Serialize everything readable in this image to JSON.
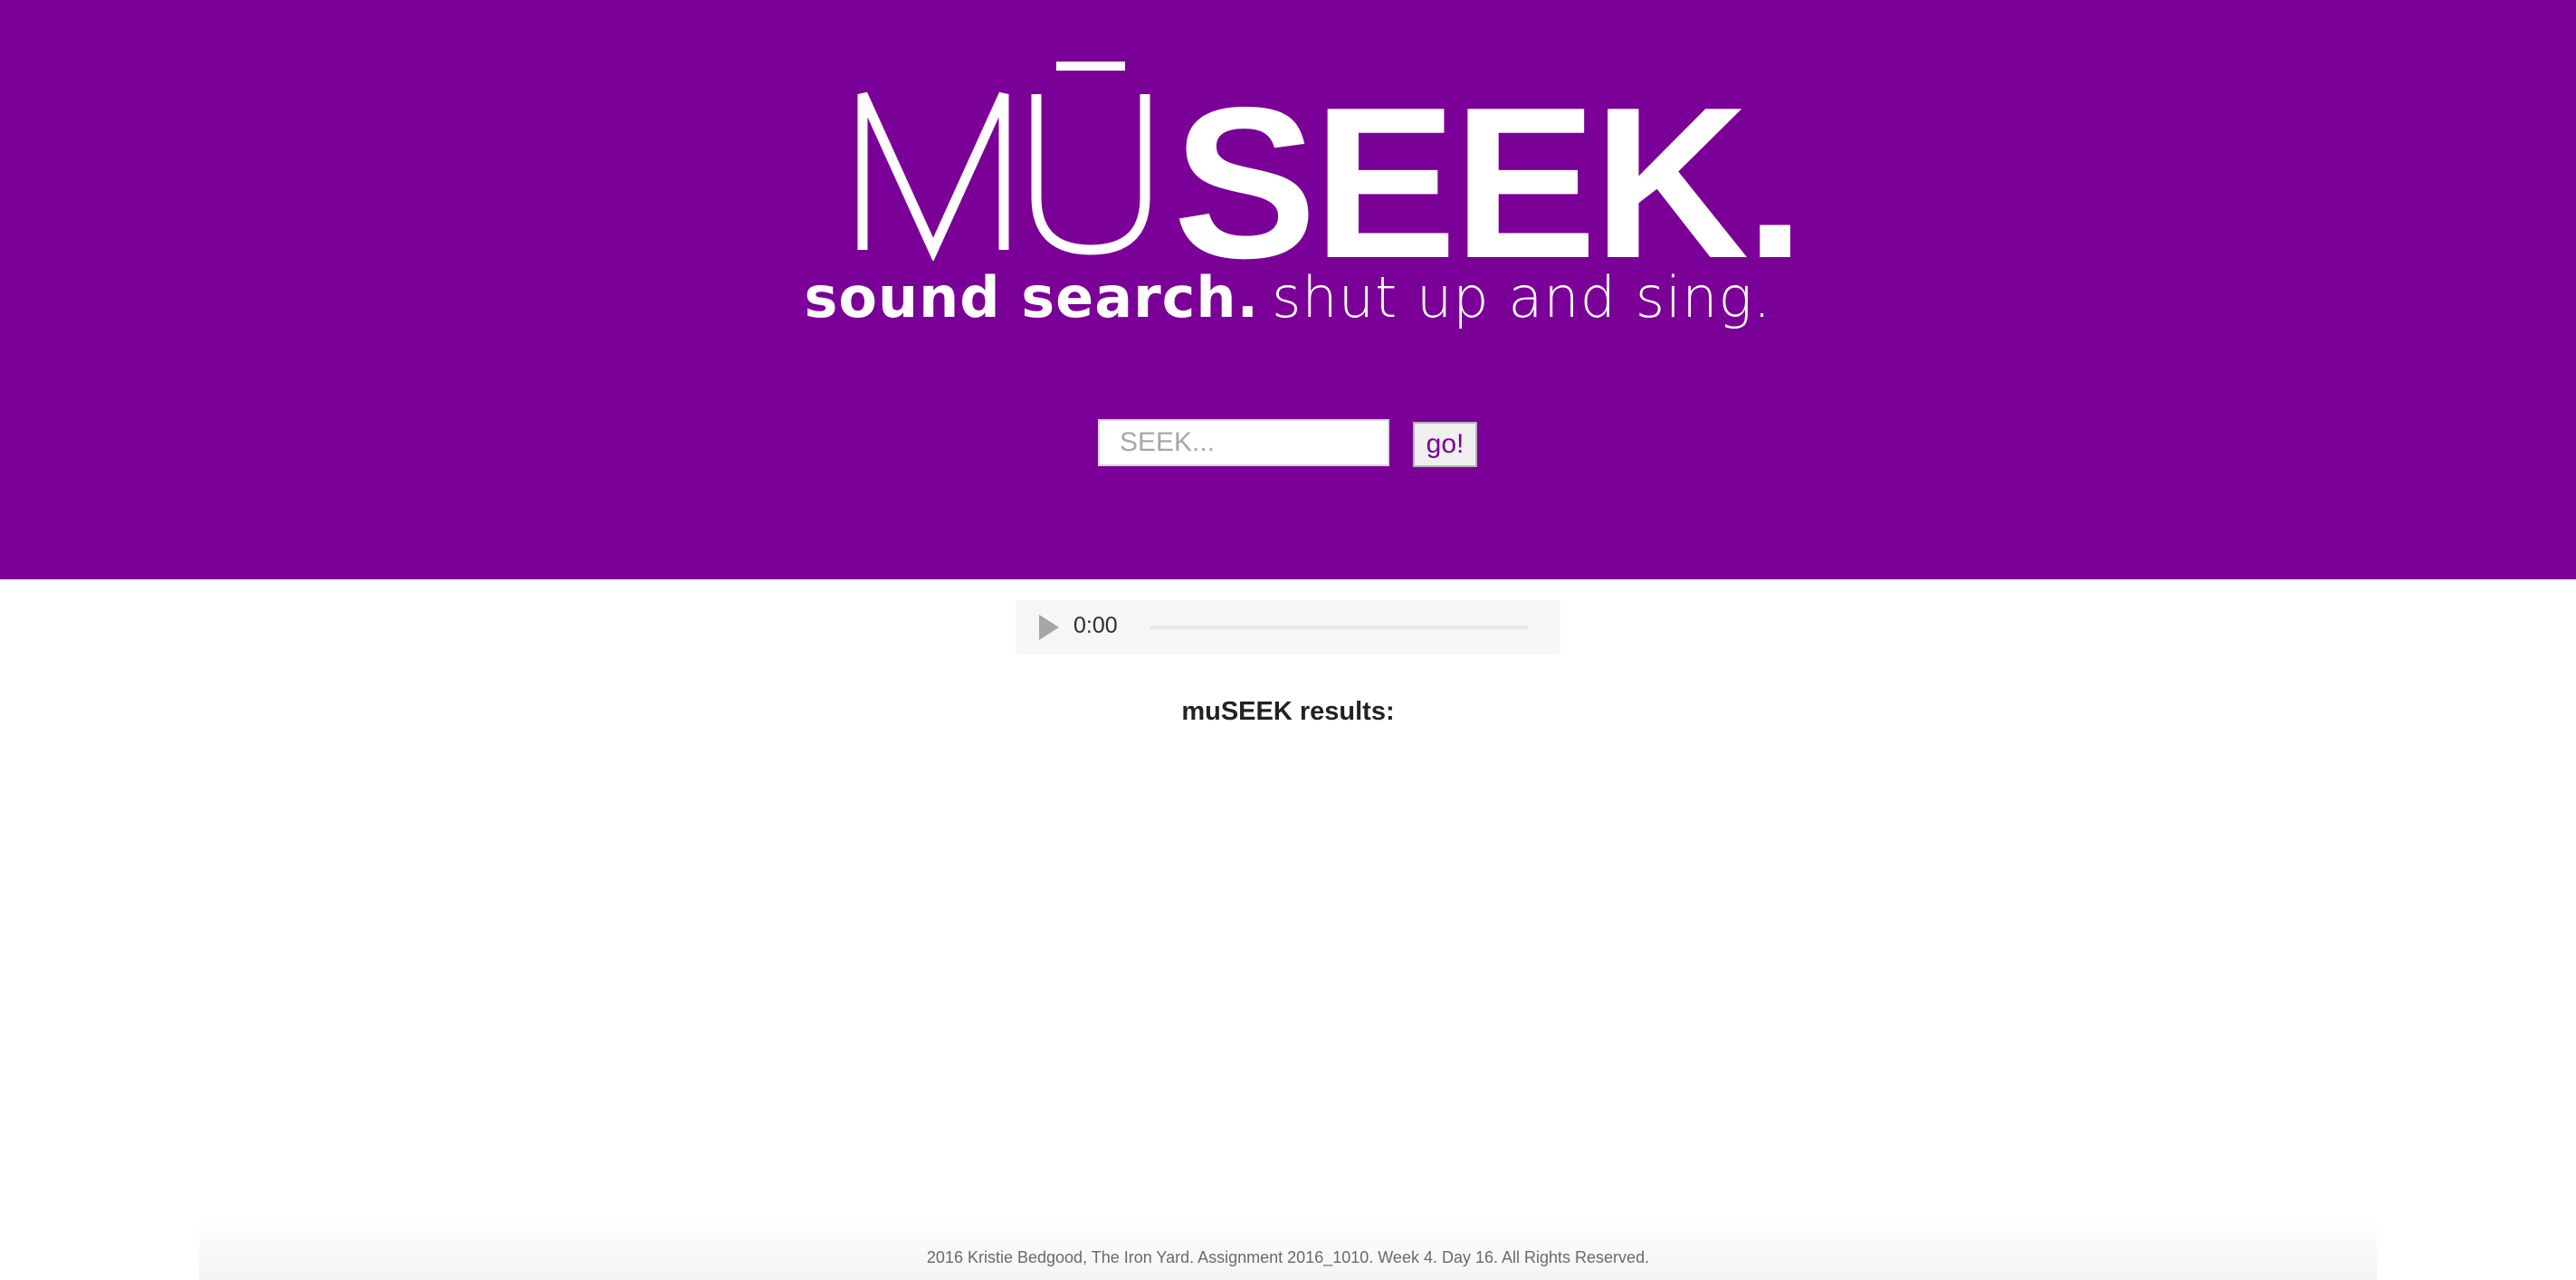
{
  "header": {
    "logo_light": "MŪ",
    "logo_bold": "SEEK.",
    "tagline_bold": "sound search.",
    "tagline_light": "shut up and sing."
  },
  "search": {
    "placeholder": "SEEK...",
    "value": "",
    "button_label": "go!"
  },
  "player": {
    "time": "0:00",
    "progress": 0
  },
  "results": {
    "heading": "muSEEK results:",
    "items": []
  },
  "footer": {
    "text": "2016 Kristie Bedgood, The Iron Yard. Assignment 2016_1010. Week 4. Day 16. All Rights Reserved."
  },
  "colors": {
    "brand_purple": "#7b0097",
    "button_text": "#7b0097",
    "player_bg": "#f6f6f6"
  }
}
